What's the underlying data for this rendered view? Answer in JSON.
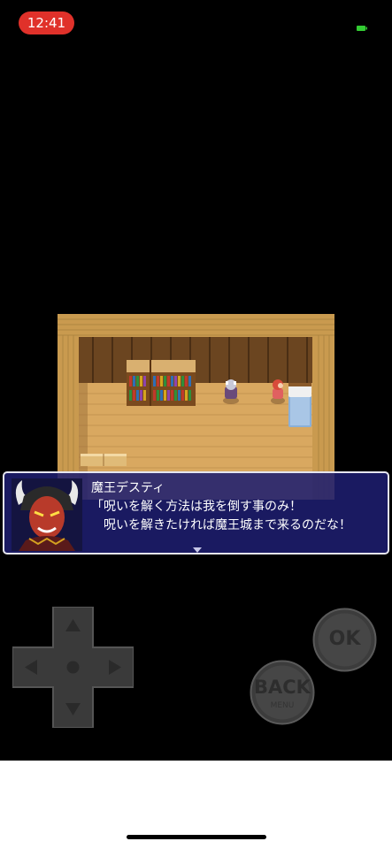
{
  "status_bar": {
    "time": "12:41",
    "battery_color": "#33cc33",
    "icon": "battery-icon"
  },
  "game": {
    "scene": "wooden room interior with bookshelves, bed and two characters",
    "dialog": {
      "speaker": "魔王デスティ",
      "line1": "「呪いを解く方法は我を倒す事のみ！",
      "line2": "呪いを解きたければ魔王城まで来るのだな！",
      "continue_icon": "continue-arrow-icon"
    }
  },
  "controls": {
    "dpad_icon": "dpad-icon",
    "ok_label": "OK",
    "back_label": "BACK",
    "back_sublabel": "MENU"
  },
  "colors": {
    "dialog_bg": "#1e1e6e",
    "status_pill": "#e0312a",
    "floor": "#d9a860",
    "wall": "#6b4520"
  }
}
